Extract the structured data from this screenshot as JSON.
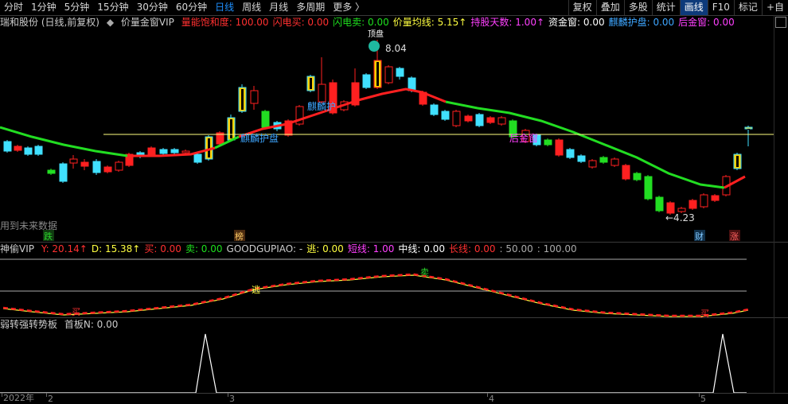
{
  "toolbar": {
    "periods": [
      "分时",
      "1分钟",
      "5分钟",
      "15分钟",
      "30分钟",
      "60分钟",
      "日线",
      "周线",
      "月线",
      "多周期",
      "更多 〉"
    ],
    "active_period": "日线",
    "right_buttons": [
      "复权",
      "叠加",
      "多股",
      "统计",
      "画线",
      "F10",
      "标记",
      "+自"
    ],
    "active_right": "画线"
  },
  "main_pane": {
    "stock_title": "瑞和股份 (日线,前复权)",
    "indicator_name": "价量金窗VIP",
    "indicators": [
      {
        "label": "量能饱和度: 100.00",
        "color": "#ff3030"
      },
      {
        "label": "闪电买: 0.00",
        "color": "#ff3030"
      },
      {
        "label": "闪电卖: 0.00",
        "color": "#1ee01e"
      },
      {
        "label": "价量均线: 5.15↑",
        "color": "#ffff40"
      },
      {
        "label": "持股天数: 1.00↑",
        "color": "#ff40ff"
      },
      {
        "label": "资金窗: 0.00",
        "color": "#ffffff"
      },
      {
        "label": "麒麟护盘: 0.00",
        "color": "#3ea6ff"
      },
      {
        "label": "后金窗: 0.00",
        "color": "#ff40ff"
      }
    ],
    "high_label": "8.04",
    "low_label": "←4.23",
    "top_tag": "顶盘",
    "annotation_qilin1": "麒麟护",
    "annotation_qilin2": "麒麟护盘",
    "annotation_houjin": "后金窗",
    "future_data_text": "用到未来数据",
    "markers": [
      {
        "text": "跌",
        "color": "#2ad42a",
        "bg": "#103a10"
      },
      {
        "text": "榜",
        "color": "#ffcc66",
        "bg": "#4a2a10"
      },
      {
        "text": "财",
        "color": "#80c8ff",
        "bg": "#10304a"
      },
      {
        "text": "涨",
        "color": "#ff6060",
        "bg": "#4a1010"
      }
    ]
  },
  "pane2": {
    "indicator_name": "神偷VIP",
    "values": [
      {
        "label": "Y: 20.14↑",
        "color": "#ff3030"
      },
      {
        "label": "D: 15.38↑",
        "color": "#ffff40"
      },
      {
        "label": "买: 0.00",
        "color": "#ff3030"
      },
      {
        "label": "卖: 0.00",
        "color": "#1ee01e"
      },
      {
        "label": "GOODGUPIAO: -",
        "color": "#cccccc"
      },
      {
        "label": "逃: 0.00",
        "color": "#ffff40"
      },
      {
        "label": "短线: 1.00",
        "color": "#ff40ff"
      },
      {
        "label": "中线: 0.00",
        "color": "#ffffff"
      },
      {
        "label": "长线: 0.00",
        "color": "#ff3030"
      },
      {
        "label": ": 50.00",
        "color": "#aaaaaa"
      },
      {
        "label": ": 100.00",
        "color": "#aaaaaa"
      }
    ],
    "signal_escape": "逃",
    "signal_sell": "卖",
    "signal_buy1": "买",
    "signal_buy2": "买"
  },
  "pane3": {
    "indicator_name": "弱转强转势板",
    "value": "首板N: 0.00"
  },
  "xaxis": {
    "labels": [
      "2022年",
      "2",
      "3",
      "4",
      "5"
    ]
  },
  "colors": {
    "up": "#ff2020",
    "down": "#40e0ff",
    "ma_green": "#22dd22",
    "ma_red": "#ff2020",
    "yellow": "#ffff40"
  }
}
